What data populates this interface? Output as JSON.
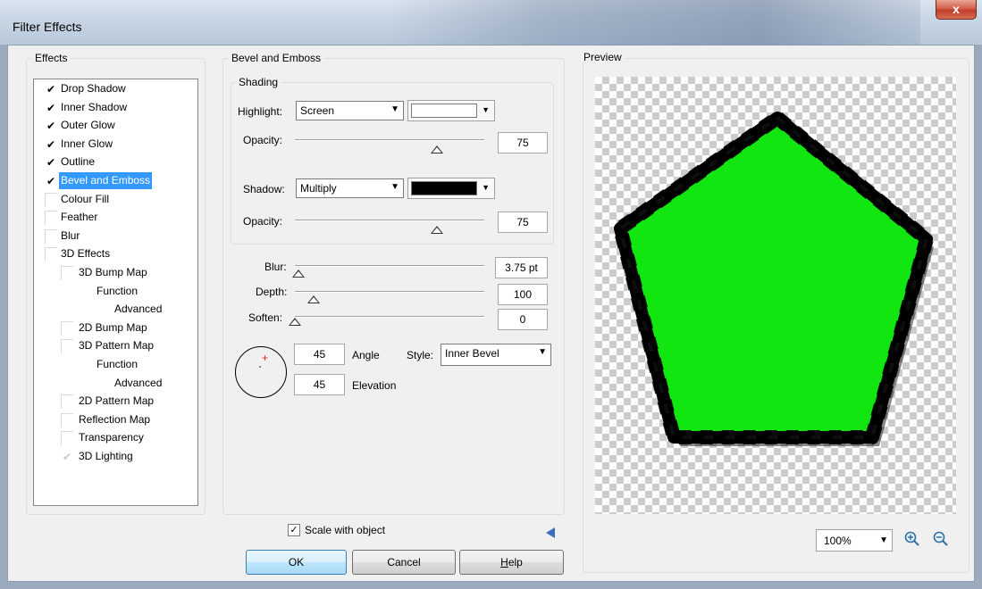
{
  "window": {
    "title": "Filter Effects",
    "close_label": "x"
  },
  "effects": {
    "legend": "Effects",
    "items": [
      {
        "label": "Drop Shadow",
        "checked": true
      },
      {
        "label": "Inner Shadow",
        "checked": true
      },
      {
        "label": "Outer Glow",
        "checked": true
      },
      {
        "label": "Inner Glow",
        "checked": true
      },
      {
        "label": "Outline",
        "checked": true
      },
      {
        "label": "Bevel and Emboss",
        "checked": true,
        "selected": true
      },
      {
        "label": "Colour Fill",
        "checked": false
      },
      {
        "label": "Feather",
        "checked": false
      },
      {
        "label": "Blur",
        "checked": false
      },
      {
        "label": "3D Effects",
        "checked": false
      },
      {
        "label": "3D Bump Map",
        "checked": false
      },
      {
        "label": "Function"
      },
      {
        "label": "Advanced"
      },
      {
        "label": "2D Bump Map",
        "checked": false
      },
      {
        "label": "3D Pattern Map",
        "checked": false
      },
      {
        "label": "Function"
      },
      {
        "label": "Advanced"
      },
      {
        "label": "2D Pattern Map",
        "checked": false
      },
      {
        "label": "Reflection Map",
        "checked": false
      },
      {
        "label": "Transparency",
        "checked": false
      },
      {
        "label": "3D Lighting",
        "checked": true,
        "greyed": true
      }
    ]
  },
  "bevel": {
    "legend": "Bevel and Emboss",
    "shading_legend": "Shading",
    "highlight_label": "Highlight:",
    "highlight_mode": "Screen",
    "highlight_color": "#ffffff",
    "highlight_opacity_label": "Opacity:",
    "highlight_opacity": "75",
    "shadow_label": "Shadow:",
    "shadow_mode": "Multiply",
    "shadow_color": "#000000",
    "shadow_opacity_label": "Opacity:",
    "shadow_opacity": "75",
    "blur_label": "Blur:",
    "blur_value": "3.75 pt",
    "depth_label": "Depth:",
    "depth_value": "100",
    "soften_label": "Soften:",
    "soften_value": "0",
    "angle_value": "45",
    "angle_label": "Angle",
    "elevation_value": "45",
    "elevation_label": "Elevation",
    "style_label": "Style:",
    "style_value": "Inner Bevel"
  },
  "preview": {
    "legend": "Preview",
    "zoom": "100%",
    "shape_color": "#11e611"
  },
  "footer": {
    "scale_label": "Scale with object",
    "ok_label": "OK",
    "cancel_label": "Cancel",
    "help_label": "Help"
  }
}
